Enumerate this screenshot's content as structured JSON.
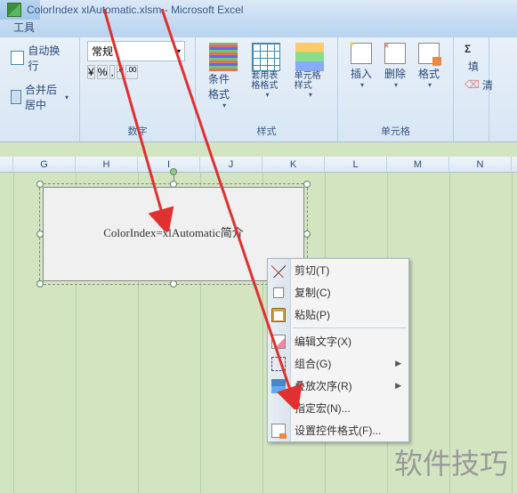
{
  "titlebar": {
    "filename": "ColorIndex xlAutomatic.xlsm",
    "app": "Microsoft Excel"
  },
  "tabbar": {
    "tool_tab": "工具"
  },
  "ribbon": {
    "wrap_text": "自动换行",
    "merge_center": "合并后居中",
    "number_format": "常规",
    "group_number": "数字",
    "cond_format": "条件格式",
    "as_table": "套用表格格式",
    "cell_styles": "单元格样式",
    "group_styles": "样式",
    "insert": "插入",
    "delete": "删除",
    "format": "格式",
    "group_cells": "单元格",
    "sum_sigma": "Σ",
    "fill_label": "填",
    "clear_label": "清"
  },
  "columns": [
    "G",
    "H",
    "I",
    "J",
    "K",
    "L",
    "M",
    "N"
  ],
  "textbox": {
    "content": "ColorIndex=xlAutomatic简介"
  },
  "context_menu": {
    "cut": "剪切(T)",
    "copy": "复制(C)",
    "paste": "粘贴(P)",
    "edit_text": "编辑文字(X)",
    "group": "组合(G)",
    "order": "叠放次序(R)",
    "assign_macro": "指定宏(N)...",
    "format_control": "设置控件格式(F)..."
  },
  "watermark": "软件技巧"
}
